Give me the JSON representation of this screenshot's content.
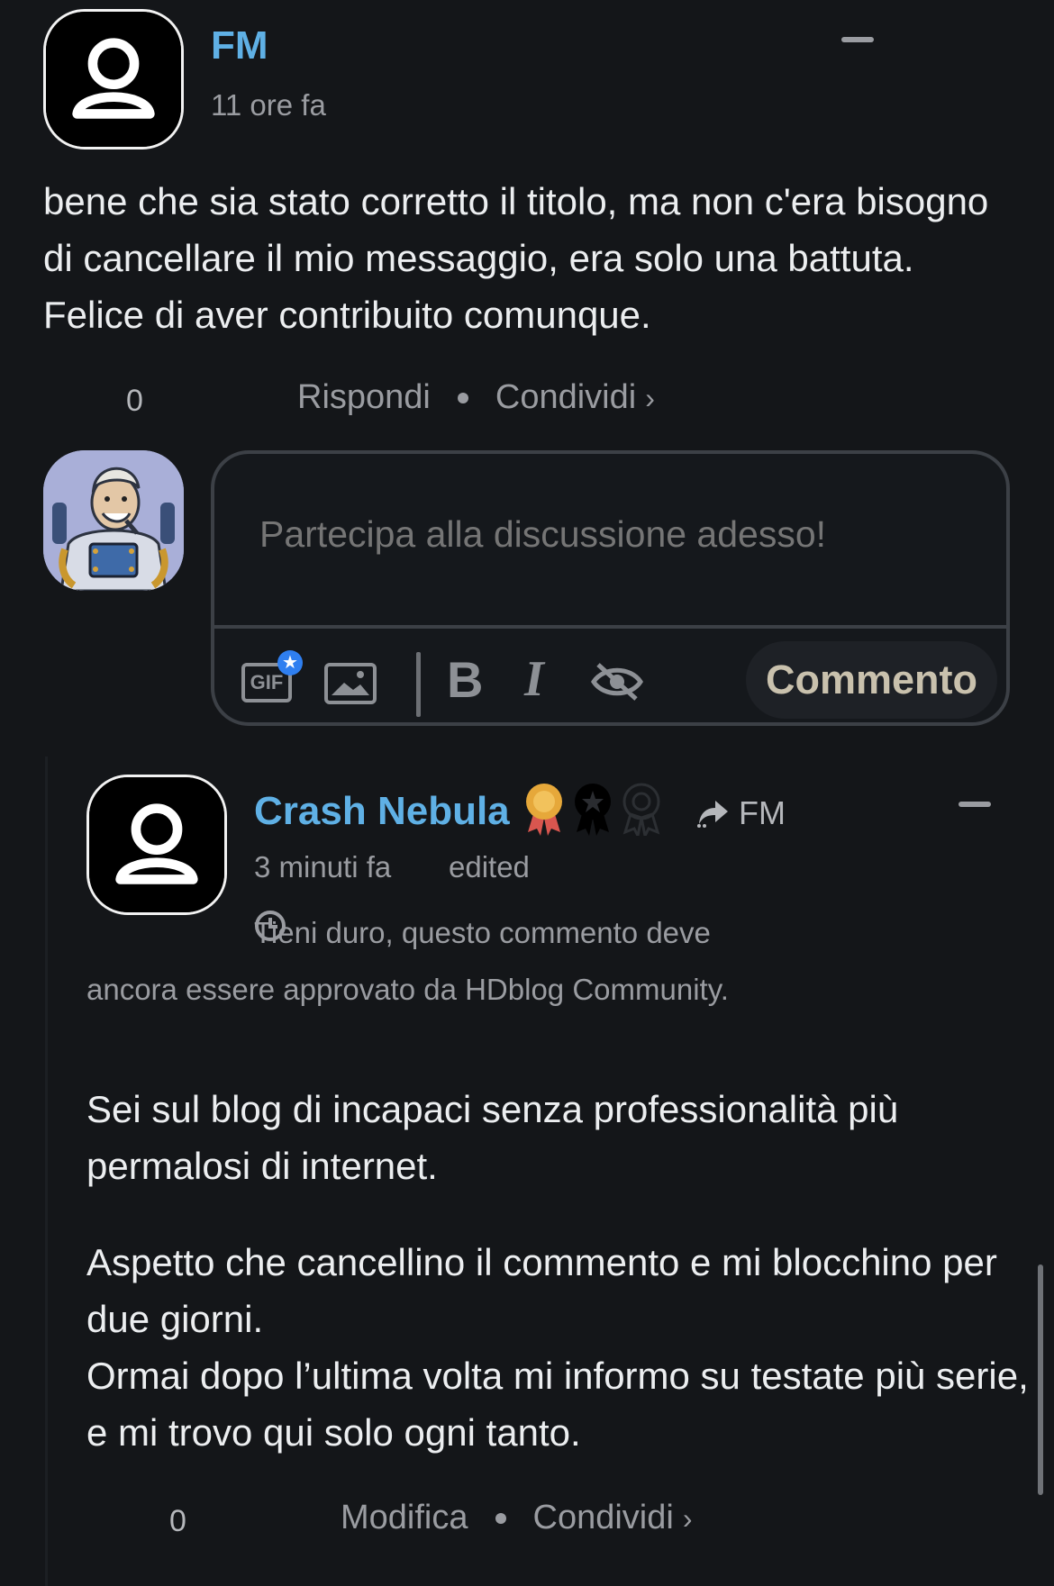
{
  "comment1": {
    "author": "FM",
    "time": "11 ore fa",
    "body": "bene che sia stato corretto il titolo, ma non c'era bisogno di cancellare il mio messaggio, era solo una battuta. Felice di aver contribuito comunque.",
    "votes": "0",
    "reply_label": "Rispondi",
    "share_label": "Condividi",
    "chevron": "›"
  },
  "composer": {
    "placeholder": "Partecipa alla discussione adesso!",
    "gif_label": "GIF",
    "gif_badge": "★",
    "bold_label": "B",
    "italic_label": "I",
    "submit_label": "Commento"
  },
  "comment2": {
    "author": "Crash Nebula",
    "reply_to": "FM",
    "time": "3 minuti fa",
    "edited": "edited",
    "pending": "Tieni duro, questo commento deve ancora essere approvato da HDblog Community.",
    "paragraphs": [
      "Sei sul blog di incapaci senza professionalità più permalosi di internet.",
      "Aspetto che cancellino il commento e mi blocchino per due giorni.\nOrmai dopo l’ultima volta mi informo su testate più serie, e mi trovo qui solo ogni tanto."
    ],
    "votes": "0",
    "edit_label": "Modifica",
    "share_label": "Condividi",
    "chevron": "›"
  },
  "colors": {
    "background": "#141619",
    "author": "#5fb0e5",
    "muted": "#9a9ca1",
    "accent_badge": "#2f7ff0"
  },
  "icons": [
    "user-avatar-icon",
    "gif-icon",
    "image-icon",
    "bold-icon",
    "italic-icon",
    "spoiler-eye-icon",
    "reply-arrow-icon",
    "clock-icon",
    "collapse-icon",
    "badge-icon"
  ]
}
